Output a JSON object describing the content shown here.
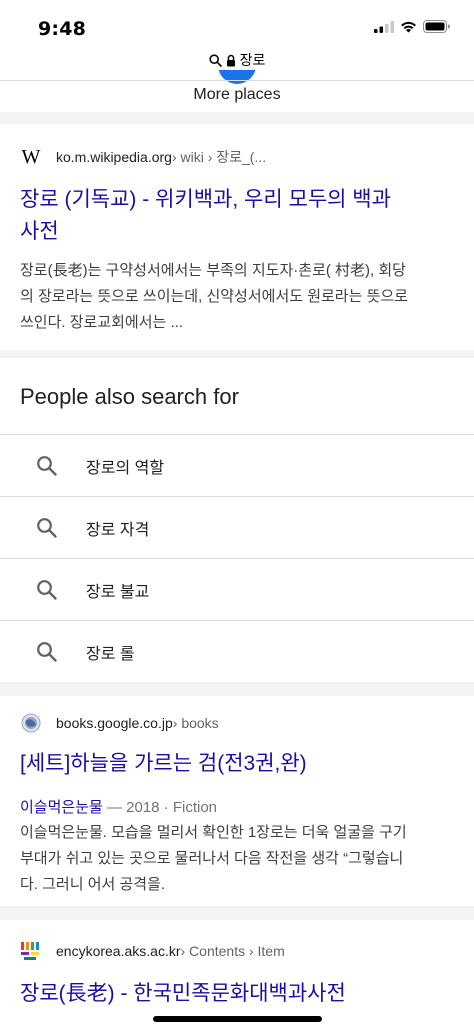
{
  "status_bar": {
    "time": "9:48"
  },
  "url_bar": {
    "domain": "장로"
  },
  "more_places": "More places",
  "results": [
    {
      "site": "ko.m.wikipedia.org",
      "path": " › wiki › 장로_(...",
      "favicon": "W",
      "title_line1": "장로 (기독교) - 위키백과, 우리 모두의 백과",
      "title_line2": "사전",
      "snippet_lines": [
        "장로(長老)는 구약성서에서는 부족의 지도자·촌로( 村老), 회당",
        "의 장로라는 뜻으로 쓰이는데, 신약성서에서도 원로라는 뜻으로",
        "쓰인다. 장로교회에서는 ..."
      ]
    },
    {
      "site": "books.google.co.jp",
      "path": " › books",
      "title_line1": "[세트]하늘을 가르는 검(전3권,완)",
      "author": "이슬먹은눈물",
      "meta": " — 2018 · Fiction",
      "snippet_lines": [
        "이슬먹은눈물. 모습을 멀리서 확인한 1장로는 더욱 얼굴을 구기",
        "부대가 쉬고 있는 곳으로 물러나서 다음 작전을 생각 “그렇습니",
        "다. 그러니 어서 공격을."
      ]
    },
    {
      "site": "encykorea.aks.ac.kr",
      "path": " › Contents › Item",
      "title_line1": "장로(長老) - 한국민족문화대백과사전"
    }
  ],
  "people_also_search": {
    "title": "People also search for",
    "items": [
      "장로의 역할",
      "장로 자격",
      "장로 불교",
      "장로 롤"
    ]
  },
  "colors": {
    "link": "#1a0dab",
    "text": "#202124",
    "snippet": "#3c4043",
    "muted": "#70757a",
    "divider": "#dadce0",
    "band": "#f1f3f4",
    "accent": "#1a73e8"
  }
}
